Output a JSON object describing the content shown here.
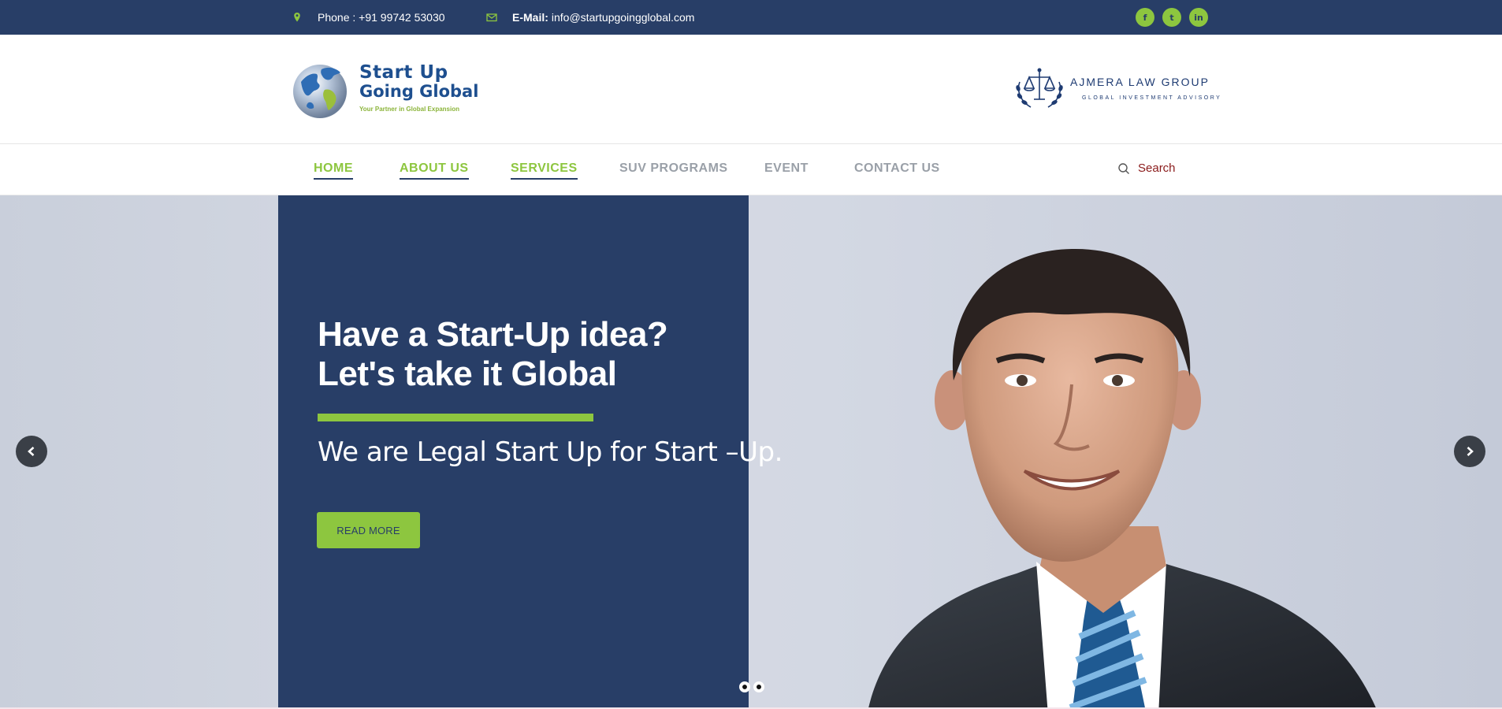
{
  "topbar": {
    "phone": "Phone : +91 99742 53030",
    "email_label": "E-Mail:",
    "email_value": "info@startupgoingglobal.com",
    "socials": [
      {
        "icon": "facebook-icon",
        "glyph": "f"
      },
      {
        "icon": "twitter-icon",
        "glyph": "t"
      },
      {
        "icon": "linkedin-icon",
        "glyph": "in"
      }
    ]
  },
  "header": {
    "logo": {
      "line1": "Start Up",
      "line2": "Going Global",
      "tagline": "Your Partner in Global Expansion"
    },
    "partner": {
      "name": "AJMERA LAW GROUP",
      "subtitle": "GLOBAL INVESTMENT ADVISORY"
    }
  },
  "nav": {
    "items": [
      {
        "label": "HOME",
        "active": true
      },
      {
        "label": "ABOUT US",
        "active": true
      },
      {
        "label": "SERVICES",
        "active": true
      },
      {
        "label": "SUV PROGRAMS",
        "active": false
      },
      {
        "label": "EVENT",
        "active": false
      },
      {
        "label": "CONTACT US",
        "active": false
      }
    ],
    "search_label": "Search"
  },
  "hero": {
    "title_line1": "Have a Start-Up idea?",
    "title_line2": "Let's take it Global",
    "subtitle": "We are Legal Start Up for Start –Up.",
    "button_label": "READ MORE",
    "slide_count": 2,
    "active_slide": 2
  },
  "colors": {
    "navy": "#283e67",
    "green": "#8dc63f",
    "nav_gray": "#9aa0a8",
    "search_red": "#8a1a1a"
  }
}
